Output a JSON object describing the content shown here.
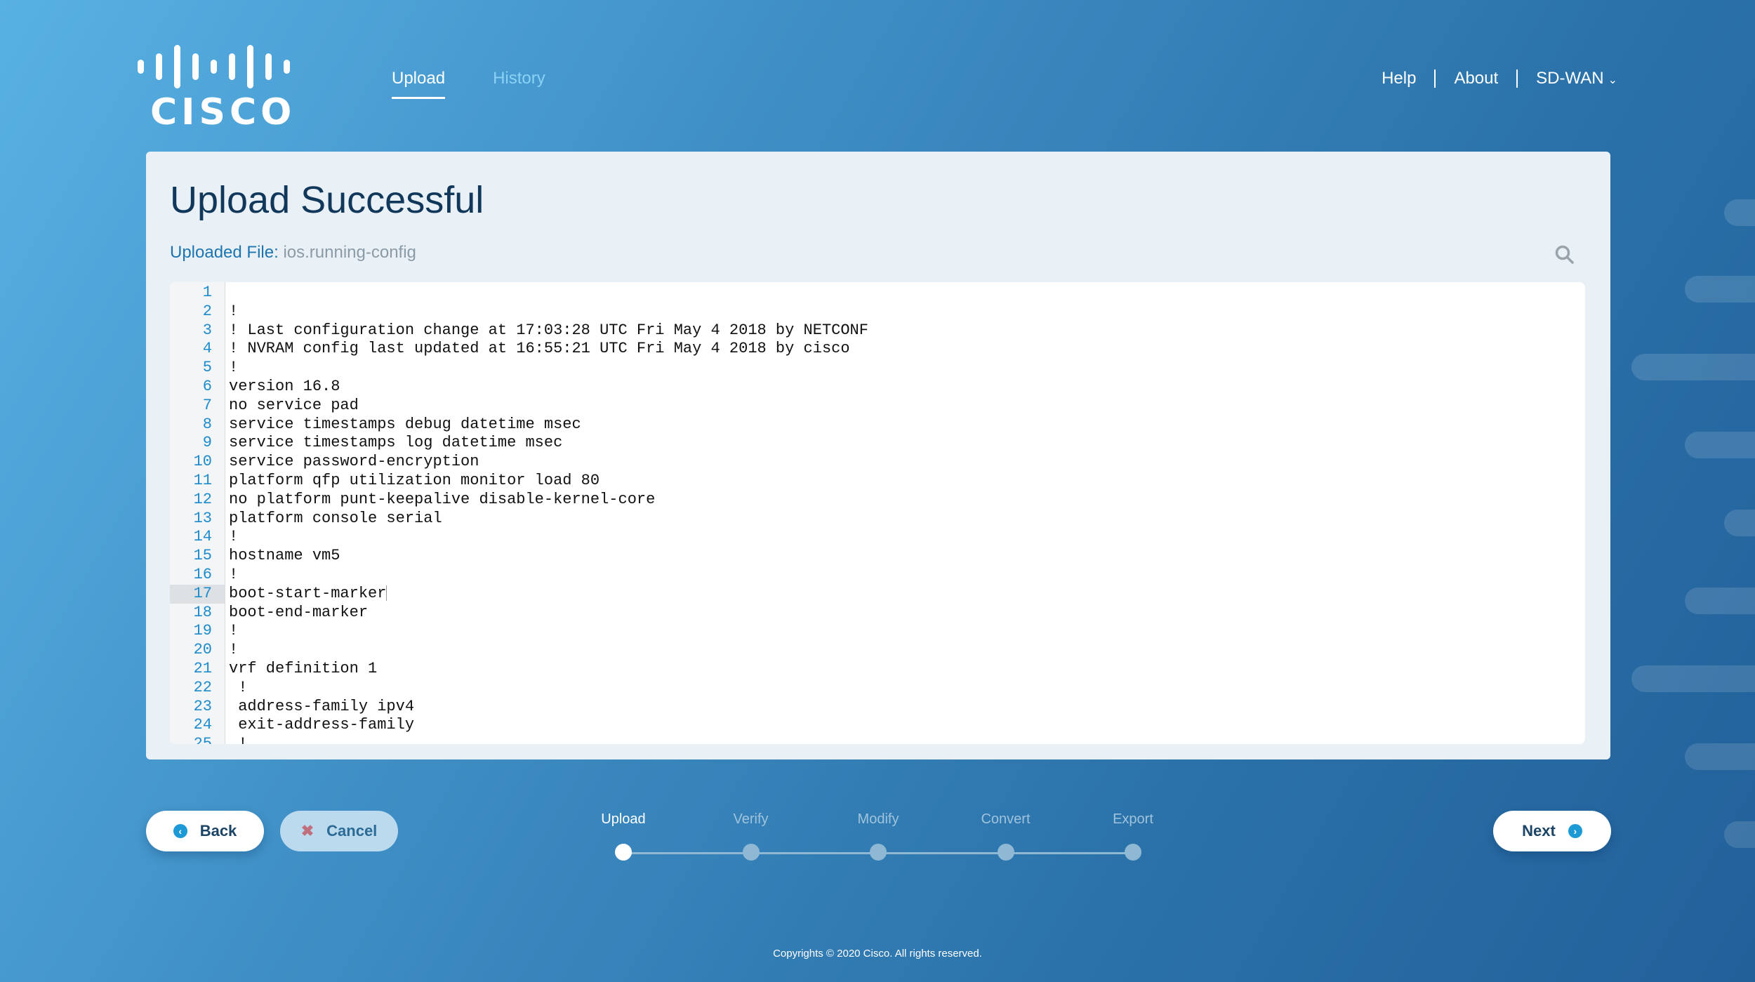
{
  "brand": {
    "logo_text": "CISCO"
  },
  "nav": {
    "tabs": [
      {
        "label": "Upload",
        "active": true
      },
      {
        "label": "History",
        "active": false
      }
    ]
  },
  "topright": {
    "help": "Help",
    "about": "About",
    "product": "SD-WAN"
  },
  "card": {
    "title": "Upload Successful",
    "file_label": "Uploaded File:",
    "file_name": "ios.running-config"
  },
  "editor": {
    "current_line": 17,
    "lines": [
      "",
      "!",
      "! Last configuration change at 17:03:28 UTC Fri May 4 2018 by NETCONF",
      "! NVRAM config last updated at 16:55:21 UTC Fri May 4 2018 by cisco",
      "!",
      "version 16.8",
      "no service pad",
      "service timestamps debug datetime msec",
      "service timestamps log datetime msec",
      "service password-encryption",
      "platform qfp utilization monitor load 80",
      "no platform punt-keepalive disable-kernel-core",
      "platform console serial",
      "!",
      "hostname vm5",
      "!",
      "boot-start-marker",
      "boot-end-marker",
      "!",
      "!",
      "vrf definition 1",
      " !",
      " address-family ipv4",
      " exit-address-family",
      " !"
    ]
  },
  "buttons": {
    "back": "Back",
    "cancel": "Cancel",
    "next": "Next"
  },
  "stepper": {
    "current_step": 1,
    "steps": [
      "Upload",
      "Verify",
      "Modify",
      "Convert",
      "Export"
    ]
  },
  "footer": {
    "text": "Copyrights © 2020 Cisco. All rights reserved."
  },
  "colors": {
    "accent": "#1d9ad6",
    "title": "#11375a",
    "file_label": "#1d74b0",
    "cancel_x": "#c0707c"
  }
}
